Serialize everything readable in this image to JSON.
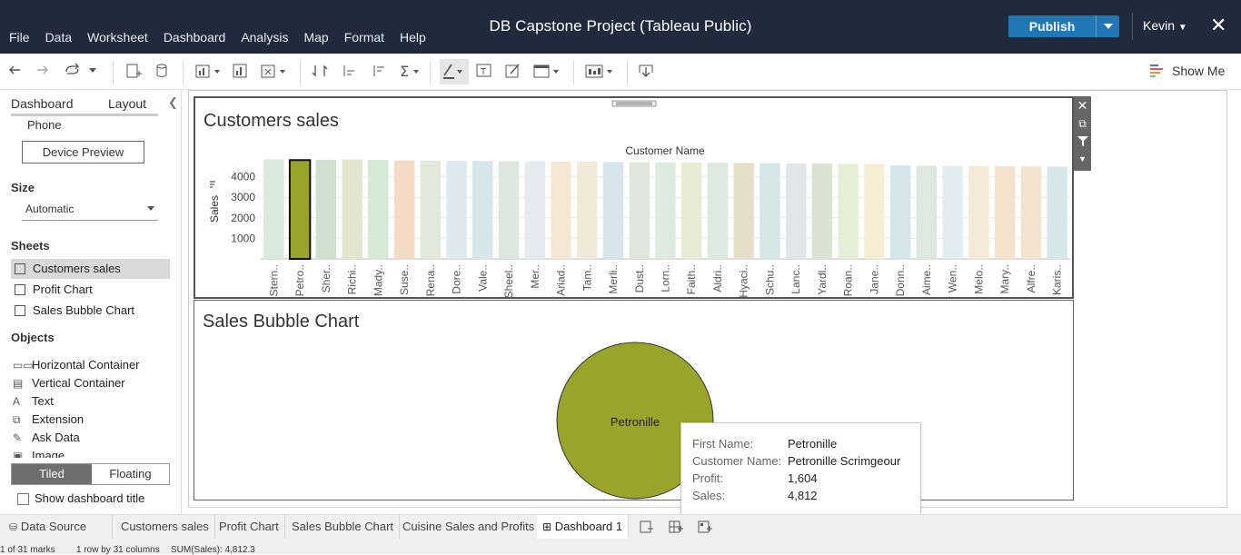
{
  "app": {
    "title": "DB Capstone Project (Tableau Public)",
    "menu": [
      "File",
      "Data",
      "Worksheet",
      "Dashboard",
      "Analysis",
      "Map",
      "Format",
      "Help"
    ],
    "publish_label": "Publish",
    "user": "Kevin",
    "show_me": "Show Me"
  },
  "left_panel": {
    "tab_dashboard": "Dashboard",
    "tab_layout": "Layout",
    "device_label": "Phone",
    "device_preview": "Device Preview",
    "size_heading": "Size",
    "size_value": "Automatic",
    "sheets_heading": "Sheets",
    "sheets": [
      "Customers sales",
      "Profit Chart",
      "Sales Bubble Chart"
    ],
    "objects_heading": "Objects",
    "objects": [
      "Horizontal Container",
      "Vertical Container",
      "Text",
      "Extension",
      "Ask Data",
      "Image"
    ],
    "tiled": "Tiled",
    "floating": "Floating",
    "show_title": "Show dashboard title"
  },
  "dashboard": {
    "zone1_title": "Customers sales",
    "zone2_title": "Sales Bubble Chart",
    "bubble_label": "Petronille"
  },
  "chart_data": [
    {
      "type": "bar",
      "title": "Customers sales",
      "xlabel": "Customer Name",
      "ylabel": "Sales",
      "ylim": [
        0,
        5000
      ],
      "yticks": [
        "4000",
        "3000",
        "2000",
        "1000"
      ],
      "categories": [
        "Stern..",
        "Petro..",
        "Sher..",
        "Richi..",
        "Mady..",
        "Suse..",
        "Rena..",
        "Dore..",
        "Vale..",
        "Sheel..",
        "Mer..",
        "Ariad..",
        "Tam..",
        "Merli..",
        "Dust..",
        "Lorn..",
        "Faith..",
        "Aldri..",
        "Hyaci..",
        "Schu..",
        "Lanc..",
        "Yardl..",
        "Roan..",
        "Jane..",
        "Donn..",
        "Aime..",
        "Wen..",
        "Melo..",
        "Mary..",
        "Alfre..",
        "Karis.."
      ],
      "values": [
        4850,
        4812,
        4830,
        4840,
        4820,
        4800,
        4790,
        4780,
        4770,
        4760,
        4750,
        4740,
        4730,
        4720,
        4710,
        4700,
        4690,
        4680,
        4670,
        4660,
        4650,
        4640,
        4630,
        4620,
        4550,
        4540,
        4530,
        4520,
        4510,
        4500,
        4490
      ],
      "colors": [
        "#dbe9dc",
        "#9aa32a",
        "#cfe0cf",
        "#e2e6cf",
        "#d6e9d4",
        "#f2dcc5",
        "#e3e9da",
        "#dde9ee",
        "#d6e7eb",
        "#dde7e1",
        "#e3ebee",
        "#f6e7d4",
        "#f1ead9",
        "#d7e6ec",
        "#e0e6dc",
        "#e0ebe0",
        "#e8ecd4",
        "#dce9de",
        "#e6dfc8",
        "#d6e5e5",
        "#e0e7e6",
        "#dde3d2",
        "#e6eed8",
        "#f6eed3",
        "#d4e6ea",
        "#dde9df",
        "#e2edf0",
        "#f5e9d8",
        "#f4e2cc",
        "#f4e4cf",
        "#d6e7ea"
      ],
      "highlighted": "Petro.."
    },
    {
      "type": "scatter",
      "title": "Sales Bubble Chart",
      "points": [
        {
          "label": "Petronille",
          "size": 4812,
          "color": "#9aa32a"
        }
      ]
    }
  ],
  "tooltip": {
    "rows": [
      {
        "key": "First Name:",
        "value": "Petronille"
      },
      {
        "key": "Customer Name:",
        "value": "Petronille Scrimgeour"
      },
      {
        "key": "Profit:",
        "value": "1,604"
      },
      {
        "key": "Sales:",
        "value": "4,812"
      }
    ]
  },
  "sheet_tabs": [
    "Data Source",
    "Customers sales",
    "Profit Chart",
    "Sales Bubble Chart",
    "Cuisine Sales and Profits",
    "Dashboard 1"
  ],
  "status": {
    "marks": "1 of 31 marks",
    "rows": "1 row by 31 columns",
    "sum": "SUM(Sales): 4,812.3"
  }
}
